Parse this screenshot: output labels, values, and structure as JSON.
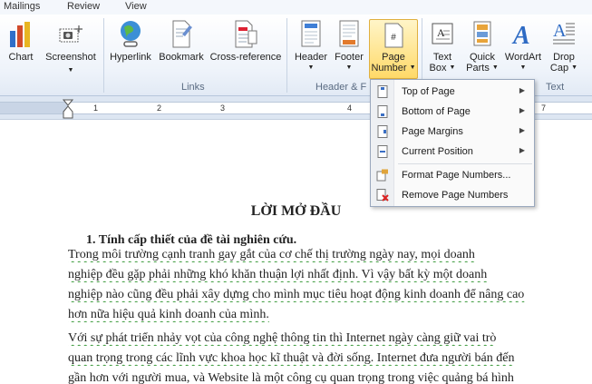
{
  "tabs": [
    "Mailings",
    "Review",
    "View"
  ],
  "ribbon": {
    "buttons": {
      "chart": "Chart",
      "screenshot": "Screenshot",
      "hyperlink": "Hyperlink",
      "bookmark": "Bookmark",
      "cross_reference": "Cross-reference",
      "header": "Header",
      "footer": "Footer",
      "page_number_line1": "Page",
      "page_number_line2": "Number",
      "text_box_line1": "Text",
      "text_box_line2": "Box",
      "quick_parts_line1": "Quick",
      "quick_parts_line2": "Parts",
      "wordart": "WordArt",
      "drop_cap_line1": "Drop",
      "drop_cap_line2": "Cap"
    },
    "groups": {
      "links": "Links",
      "header_footer": "Header & F",
      "text": "Text"
    }
  },
  "ruler": {
    "numbers": [
      "1",
      "2",
      "3",
      "4",
      "5",
      "6",
      "7"
    ]
  },
  "menu": {
    "items": [
      {
        "label": "Top of Page",
        "icon": "page-top-icon"
      },
      {
        "label": "Bottom of Page",
        "icon": "page-bottom-icon"
      },
      {
        "label": "Page Margins",
        "icon": "page-margins-icon"
      },
      {
        "label": "Current Position",
        "icon": "current-position-icon"
      },
      {
        "label": "Format Page Numbers...",
        "icon": "format-numbers-icon"
      },
      {
        "label": "Remove Page Numbers",
        "icon": "remove-numbers-icon"
      }
    ]
  },
  "document": {
    "title": "LỜI MỞ ĐẦU",
    "heading": "1.   Tính cấp thiết của đề tài nghiên cứu.",
    "lines": [
      "     Trong môi trường cạnh tranh gay gắt của cơ chế thị trường ngày nay, mọi doanh",
      "nghiệp đều gặp phải những khó khăn thuận lợi nhất định. Vì vậy bất kỳ một doanh",
      "nghiệp nào cũng đều phải xây dựng cho mình mục tiêu hoạt động kinh doanh để nâng cao",
      "hơn nữa hiệu quả kinh doanh của mình.",
      "     Với sự phát triển nhảy vọt của công nghệ thông tin thì Internet ngày càng giữ vai trò",
      "quan trọng trong các lĩnh vực khoa học kĩ thuật và đời sống. Internet đưa người bán đến",
      "gần hơn với người mua, và Website là một công cụ quan trọng trong việc quảng bá hình"
    ]
  },
  "colors": {
    "accent": "#ffd968",
    "ribbon_bg": "#eef3fa",
    "spell_underline": "#3a9a3a"
  }
}
